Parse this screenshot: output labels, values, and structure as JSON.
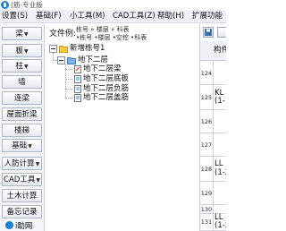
{
  "app": {
    "title": "(筋-专业版"
  },
  "menu": [
    "设置(S)",
    "基础(F)",
    "小工具(M)",
    "CAD工具(Z)",
    "帮助(H)",
    "扩展功能"
  ],
  "sidebar": {
    "items": [
      {
        "label": "梁",
        "arrow": "▼"
      },
      {
        "label": "板",
        "arrow": "▼"
      },
      {
        "label": "柱",
        "arrow": "▼"
      },
      {
        "label": "墙",
        "arrow": ""
      },
      {
        "label": "连梁",
        "arrow": ""
      },
      {
        "label": "屋面折梁",
        "arrow": ""
      },
      {
        "label": "楼梯",
        "arrow": ""
      },
      {
        "label": "基础",
        "arrow": "▼"
      },
      {
        "label": "人防计算",
        "arrow": "▼"
      },
      {
        "label": "CAD工具",
        "arrow": "▼"
      },
      {
        "label": "土木计算",
        "arrow": ""
      },
      {
        "label": "备忘记录",
        "arrow": ""
      }
    ],
    "bottom_logo_label": "i助网"
  },
  "main": {
    "file_example_label": "文件例:",
    "example_line1": "栋号 » 楼层 » 科表",
    "example_line2": "•栋号 •楼层 •空挖 •科表",
    "tree": {
      "root": "新增栋号1",
      "floor": "地下二层",
      "children": [
        "地下二层梁",
        "地下二层底板",
        "地下二层负筋",
        "地下二层盖筋"
      ]
    }
  },
  "grid": {
    "header": "构件",
    "rows": [
      {
        "num": "124",
        "text": []
      },
      {
        "num": "125",
        "text": [
          "KL",
          "(1-"
        ]
      },
      {
        "num": "126",
        "text": []
      },
      {
        "num": "127",
        "text": []
      },
      {
        "num": "128",
        "text": [
          "LL",
          "(1-2)"
        ]
      },
      {
        "num": "129",
        "text": []
      },
      {
        "num": "130",
        "text": []
      },
      {
        "num": "131",
        "text": [
          "LL",
          "(1-2)"
        ]
      }
    ]
  }
}
